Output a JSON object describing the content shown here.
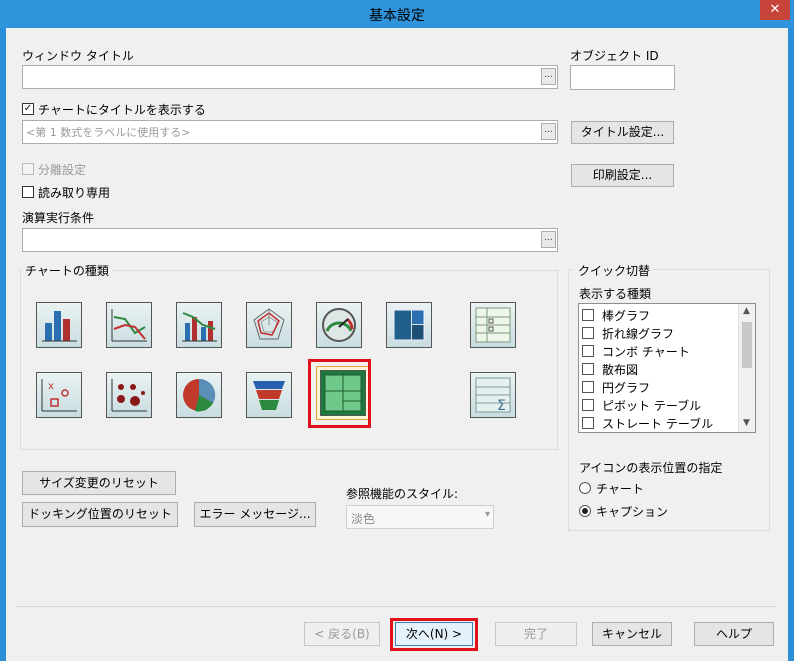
{
  "window": {
    "title": "基本設定",
    "close_glyph": "✕"
  },
  "fields": {
    "window_title_label": "ウィンドウ タイトル",
    "object_id_label": "オブジェクト ID",
    "show_title_label": "チャートにタイトルを表示する",
    "show_title_checked": true,
    "title_placeholder": "<第 1 数式をラベルに使用する>",
    "separate_label": "分離設定",
    "readonly_label": "読み取り専用",
    "calc_condition_label": "演算実行条件",
    "ellipsis": "..."
  },
  "buttons": {
    "title_settings": "タイトル設定...",
    "print_settings": "印刷設定...",
    "reset_size": "サイズ変更のリセット",
    "reset_docking": "ドッキング位置のリセット",
    "error_message": "エラー メッセージ...",
    "back": "< 戻る(B)",
    "next": "次へ(N) >",
    "finish": "完了",
    "cancel": "キャンセル",
    "help": "ヘルプ"
  },
  "chart_types": {
    "label": "チャートの種類",
    "icons": [
      "bar-chart-icon",
      "line-chart-icon",
      "combo-chart-icon",
      "radar-chart-icon",
      "gauge-chart-icon",
      "treemap-chart-icon",
      "pivot-table-icon",
      "scatter-chart-icon",
      "grid-chart-icon",
      "pie-chart-icon",
      "funnel-chart-icon",
      "block-chart-icon",
      "straight-table-icon"
    ],
    "selected": "block-chart-icon"
  },
  "reference_style": {
    "label": "参照機能のスタイル:",
    "value": "淡色"
  },
  "quick_switch": {
    "label": "クイック切替",
    "types_label": "表示する種類",
    "items": [
      "棒グラフ",
      "折れ線グラフ",
      "コンボ チャート",
      "散布図",
      "円グラフ",
      "ピボット テーブル",
      "ストレート テーブル"
    ],
    "icon_pos_label": "アイコンの表示位置の指定",
    "radio_chart": "チャート",
    "radio_caption": "キャプション",
    "radio_selected": "キャプション"
  }
}
